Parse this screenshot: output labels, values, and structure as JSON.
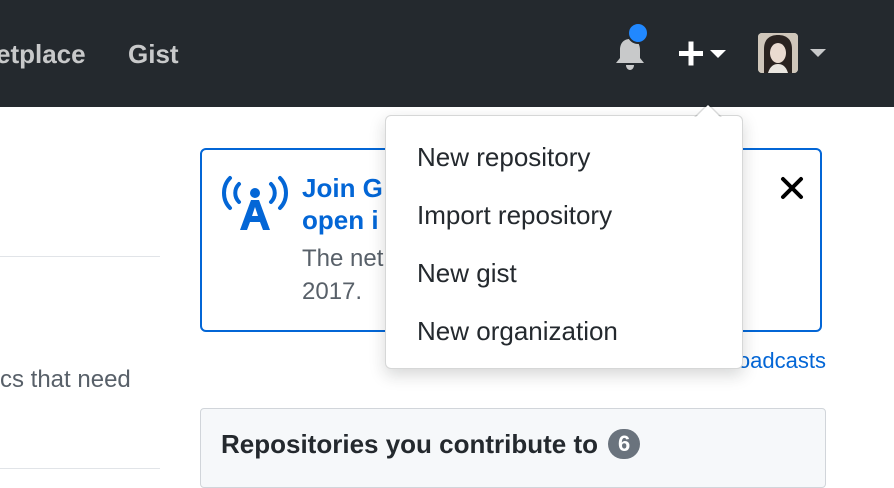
{
  "header": {
    "nav_links": [
      "etplace",
      "Gist"
    ]
  },
  "left": {
    "partial_text": "cs that need"
  },
  "broadcast": {
    "title": "Join G\nopen i",
    "body": "The net                                          12.\n2017."
  },
  "broadcast_link": "View 's new broadcasts",
  "repositories": {
    "title": "Repositories you contribute to",
    "count": "6"
  },
  "dropdown": {
    "items": [
      "New repository",
      "Import repository",
      "New gist",
      "New organization"
    ]
  },
  "colors": {
    "header_bg": "#24292e",
    "link_blue": "#0366d6",
    "notification_dot": "#2188ff",
    "counter_bg": "#6a737d"
  },
  "icons": [
    "bell-icon",
    "plus-icon",
    "caret-down-icon",
    "broadcast-icon",
    "close-icon"
  ]
}
